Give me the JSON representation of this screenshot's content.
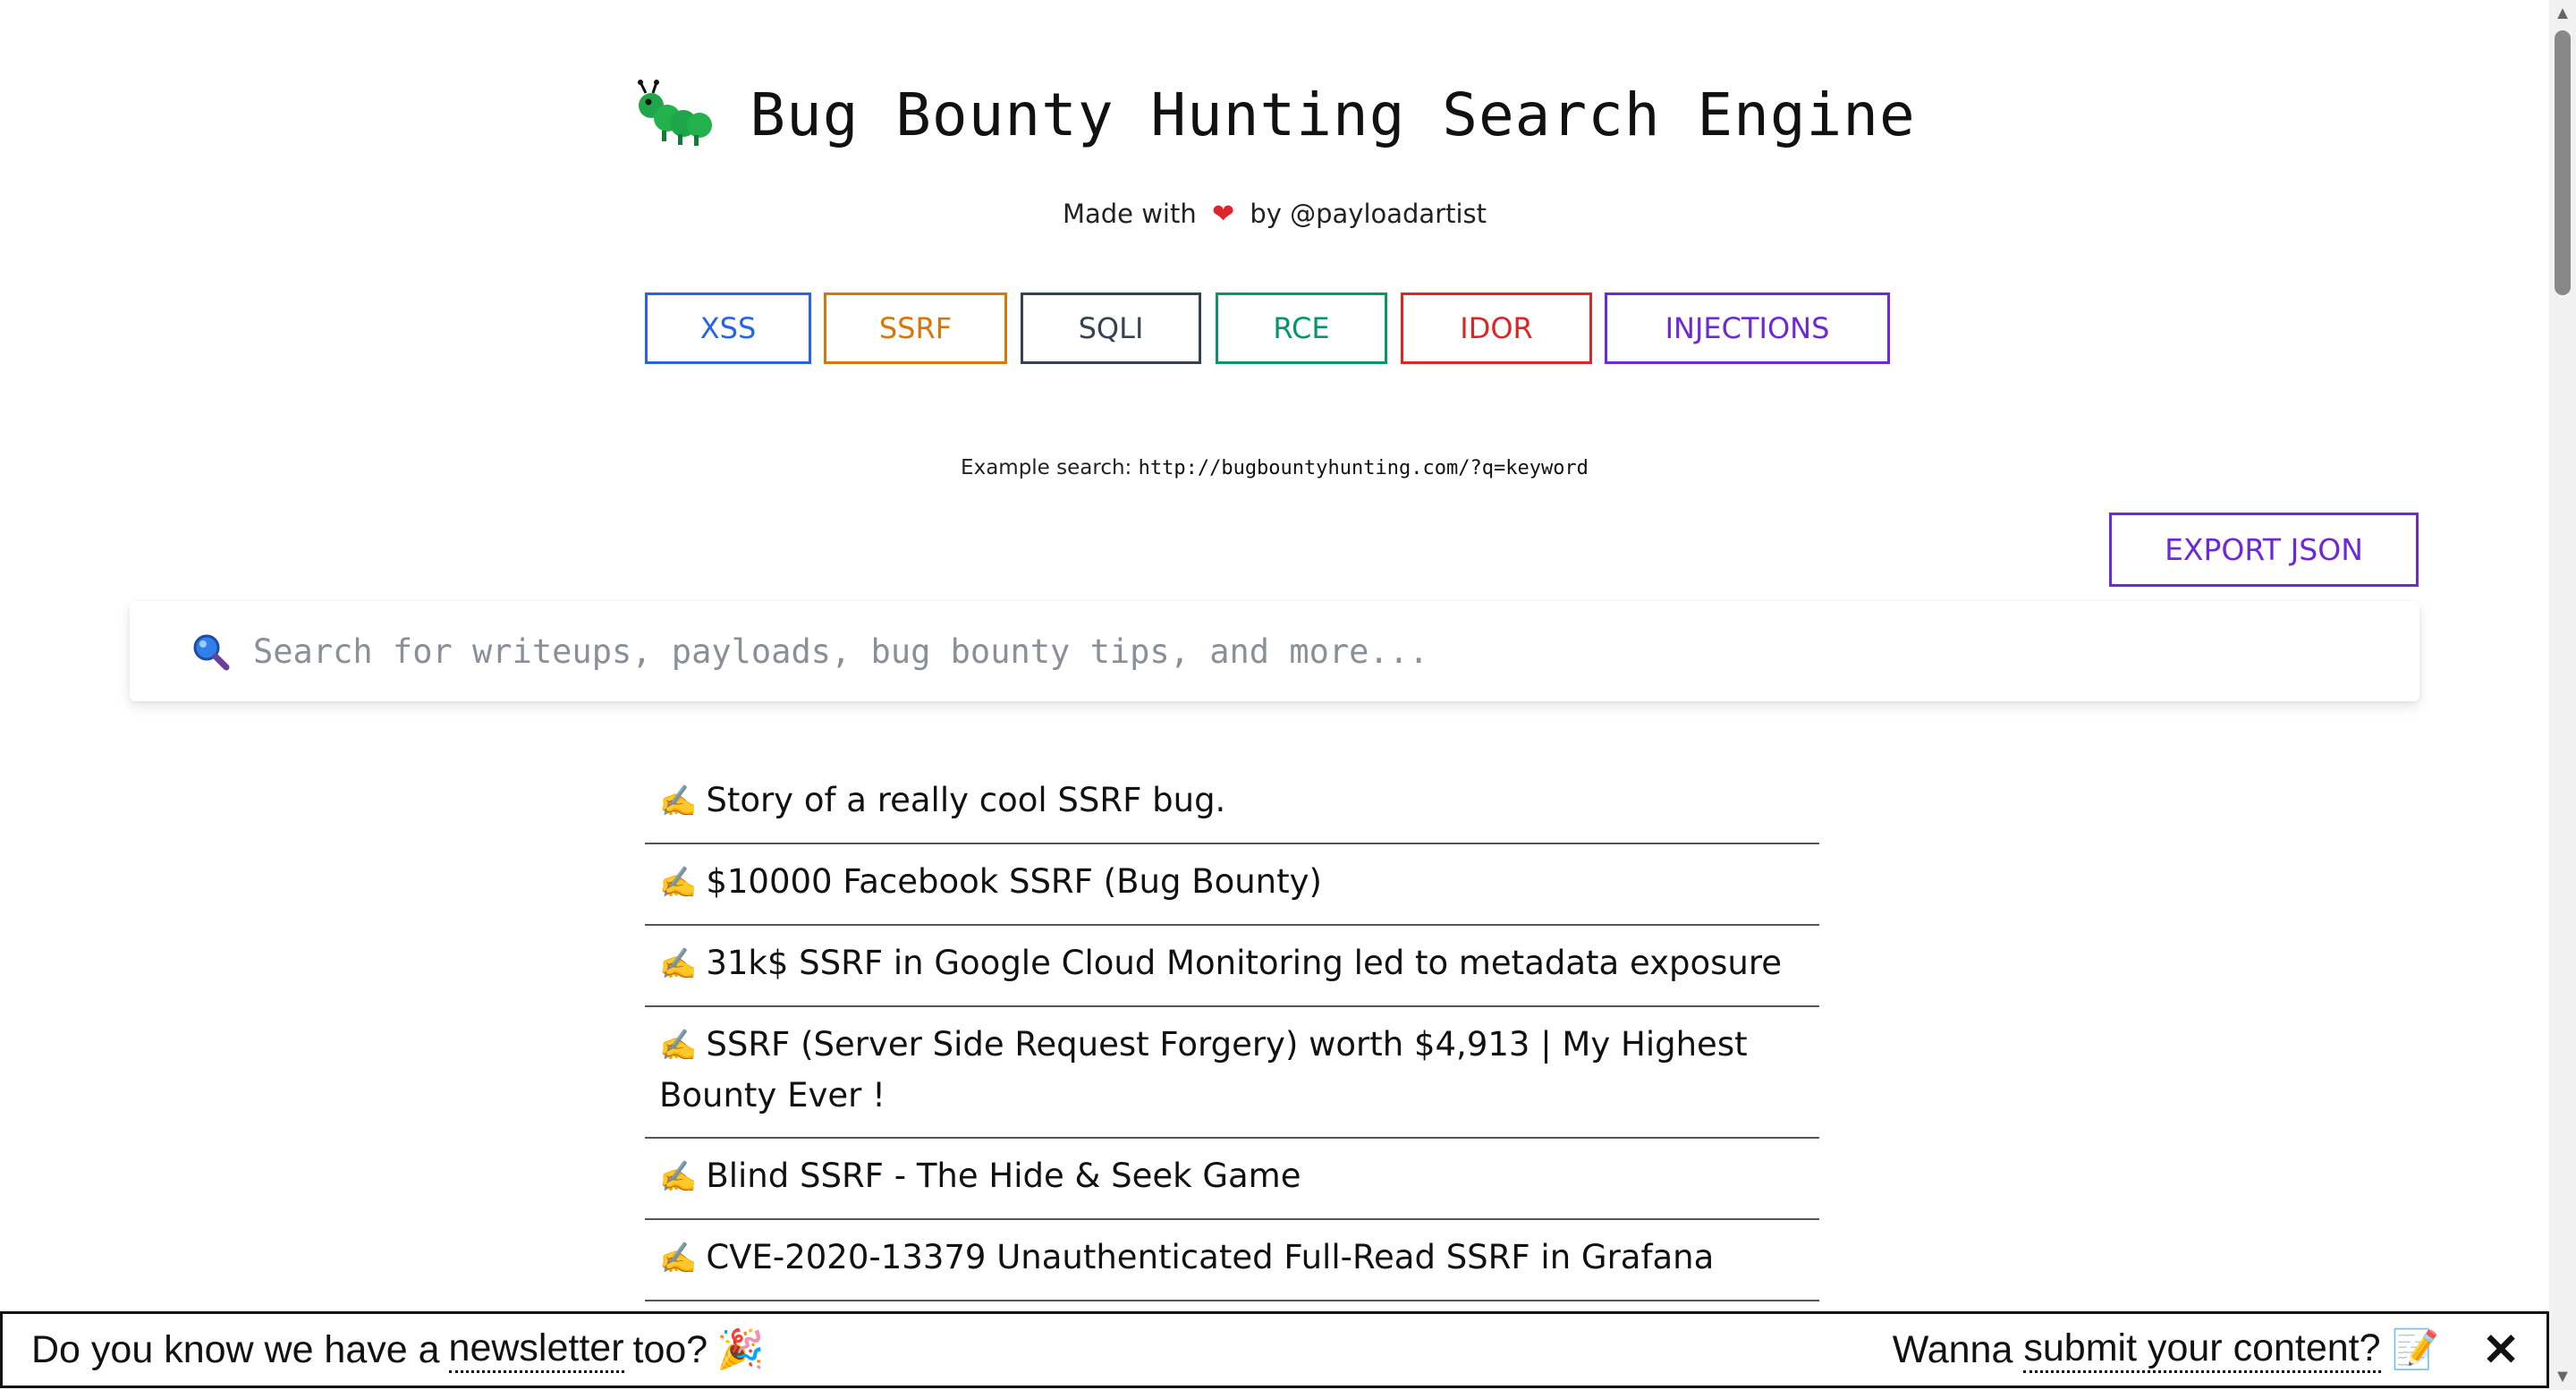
{
  "header": {
    "title": "Bug Bounty Hunting Search Engine",
    "made_with_prefix": "Made with",
    "made_with_suffix": "by @payloadartist",
    "heart_glyph": "❤"
  },
  "categories": [
    {
      "label": "XSS",
      "color": "#2563eb"
    },
    {
      "label": "SSRF",
      "color": "#d97706"
    },
    {
      "label": "SQLI",
      "color": "#374151"
    },
    {
      "label": "RCE",
      "color": "#059669"
    },
    {
      "label": "IDOR",
      "color": "#dc2626"
    },
    {
      "label": "INJECTIONS",
      "color": "#6d28d9"
    }
  ],
  "example": {
    "label": "Example search:",
    "url": "http://bugbountyhunting.com/?q=keyword"
  },
  "export_button": "EXPORT JSON",
  "search": {
    "placeholder": "Search for writeups, payloads, bug bounty tips, and more...",
    "value": ""
  },
  "results": [
    {
      "icon": "✍️",
      "title": "Story of a really cool SSRF bug."
    },
    {
      "icon": "✍️",
      "title": "$10000 Facebook SSRF (Bug Bounty)"
    },
    {
      "icon": "✍️",
      "title": "31k$ SSRF in Google Cloud Monitoring led to metadata exposure"
    },
    {
      "icon": "✍️",
      "title": "SSRF (Server Side Request Forgery) worth $4,913 | My Highest Bounty Ever !"
    },
    {
      "icon": "✍️",
      "title": "Blind SSRF - The Hide & Seek Game"
    },
    {
      "icon": "✍️",
      "title": "CVE-2020-13379 Unauthenticated Full-Read SSRF in Grafana"
    }
  ],
  "banner": {
    "left_prefix": "Do you know we have a",
    "left_link": "newsletter",
    "left_suffix": "too?",
    "left_emoji": "🎉",
    "right_prefix": "Wanna",
    "right_link": "submit your content?",
    "right_emoji": "📝",
    "close_glyph": "✕"
  },
  "icons": {
    "logo": "caterpillar-icon",
    "search": "magnifier-icon",
    "result": "writing-hand-icon"
  }
}
